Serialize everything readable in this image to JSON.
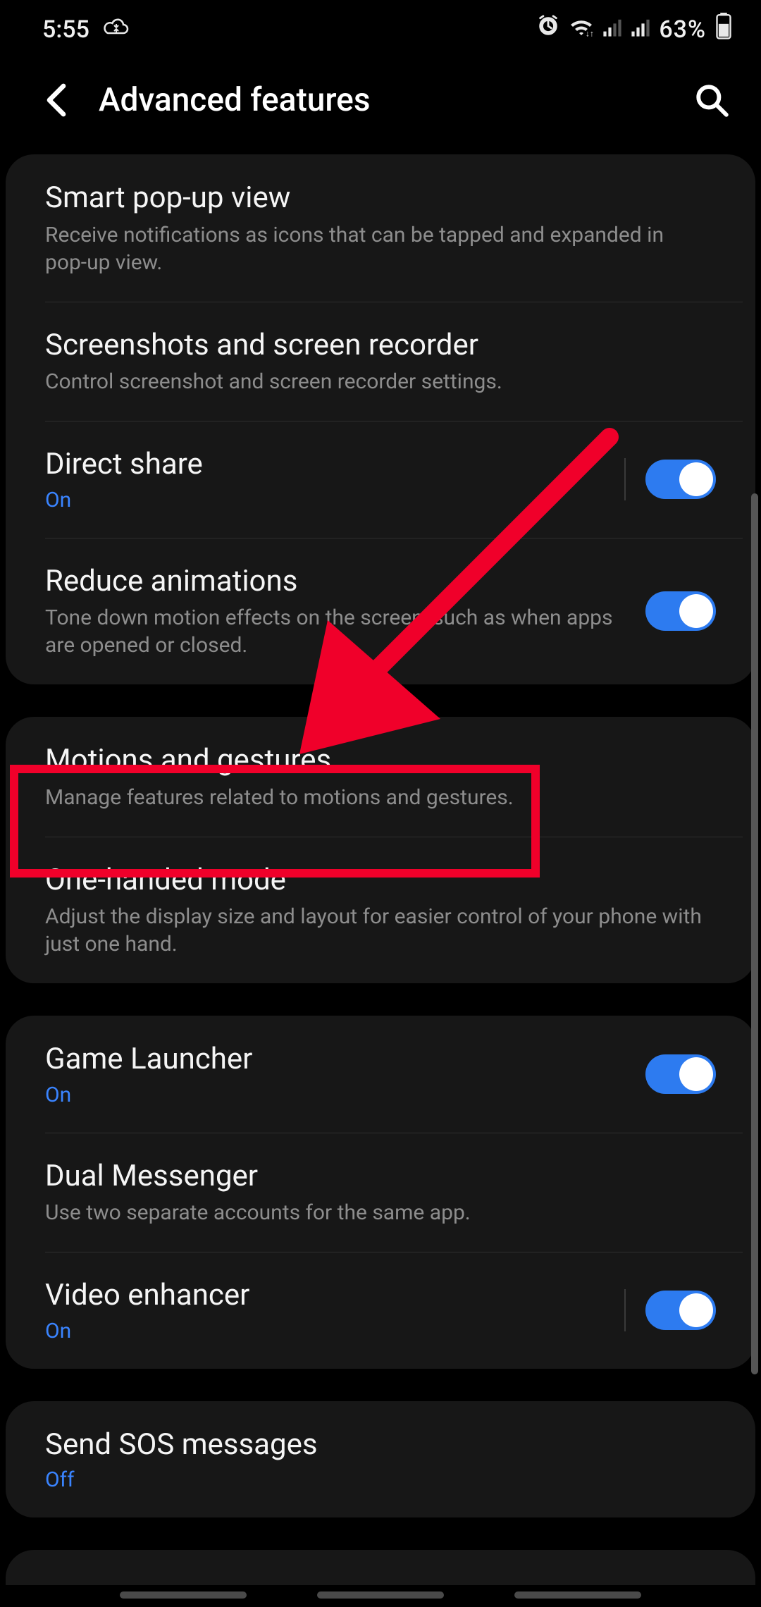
{
  "status": {
    "time": "5:55",
    "battery": "63%"
  },
  "header": {
    "title": "Advanced features"
  },
  "groups": [
    {
      "items": [
        {
          "title": "Smart pop-up view",
          "sub": "Receive notifications as icons that can be tapped and expanded in pop-up view."
        },
        {
          "title": "Screenshots and screen recorder",
          "sub": "Control screenshot and screen recorder settings."
        },
        {
          "title": "Direct share",
          "status": "On",
          "toggle": true,
          "toggle_on": true,
          "sep": true
        },
        {
          "title": "Reduce animations",
          "sub": "Tone down motion effects on the screen, such as when apps are opened or closed.",
          "toggle": true,
          "toggle_on": true
        }
      ]
    },
    {
      "items": [
        {
          "title": "Motions and gestures",
          "sub": "Manage features related to motions and gestures."
        },
        {
          "title": "One-handed mode",
          "sub": "Adjust the display size and layout for easier control of your phone with just one hand."
        }
      ]
    },
    {
      "items": [
        {
          "title": "Game Launcher",
          "status": "On",
          "toggle": true,
          "toggle_on": true
        },
        {
          "title": "Dual Messenger",
          "sub": "Use two separate accounts for the same app."
        },
        {
          "title": "Video enhancer",
          "status": "On",
          "toggle": true,
          "toggle_on": true,
          "sep": true
        }
      ]
    },
    {
      "items": [
        {
          "title": "Send SOS messages",
          "status": "Off"
        }
      ]
    }
  ]
}
